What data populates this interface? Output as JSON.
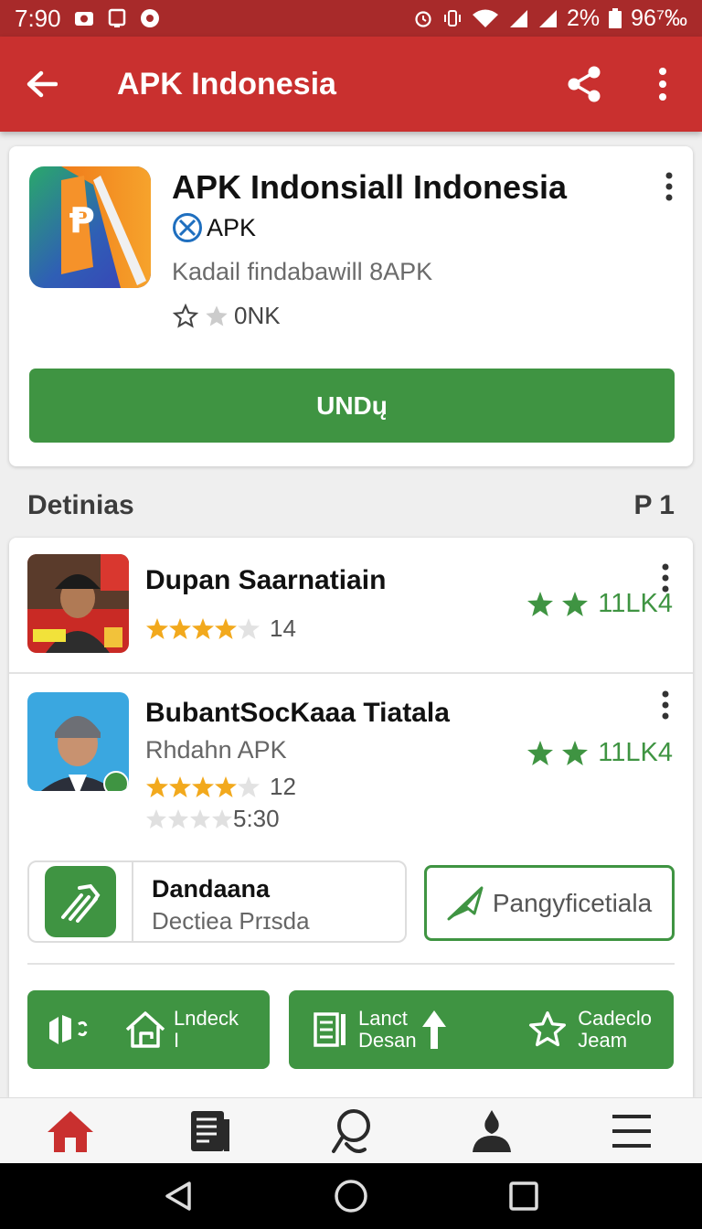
{
  "status_bar": {
    "time": "7:90",
    "battery_text": "2%",
    "battery_percent": "96⁷‰",
    "icons": [
      "camera-notification-icon",
      "device-notification-icon",
      "record-icon",
      "alarm-icon",
      "vibrate-icon",
      "wifi-icon",
      "signal-icon",
      "signal-icon",
      "battery-icon"
    ]
  },
  "app_bar": {
    "title": "APK Indonesia",
    "icons": [
      "back-arrow-icon",
      "share-icon",
      "more-vert-icon"
    ]
  },
  "hero": {
    "name": "APK Indonsiall Indonesia",
    "developer": "APK",
    "description": "Kadail findabawill 8APK",
    "rating_text": "0NK",
    "install_label": "UNDų"
  },
  "section": {
    "title": "Detinias",
    "page": "P 1"
  },
  "items": [
    {
      "name": "Dupan Saarnatiain",
      "star_count": "14",
      "stars_filled": 4,
      "score": "11LK4"
    },
    {
      "name": "BubantSocKaaa Tiatala",
      "subtitle": "Rhdahn APK",
      "star_count": "12",
      "stars_filled": 4,
      "secondary_count": "5:30",
      "score": "11LK4"
    }
  ],
  "chip": {
    "title": "Dandaana",
    "subtitle": "Dectiea Prɪsda"
  },
  "outline_button": {
    "label": "Pangyficetiala"
  },
  "green_buttons": [
    {
      "line1": "Lndeck",
      "line2": "I"
    },
    {
      "line1": "Lanct",
      "line2": "Desan"
    },
    {
      "line1": "Cadeclo",
      "line2": "Jeam"
    }
  ],
  "bottom_nav": [
    "home-icon",
    "news-icon",
    "search-icon",
    "profile-icon",
    "menu-icon"
  ],
  "colors": {
    "primary_red": "#c9302f",
    "status_red": "#a82a2a",
    "green": "#3f9442",
    "star_gold": "#f2a91d"
  }
}
